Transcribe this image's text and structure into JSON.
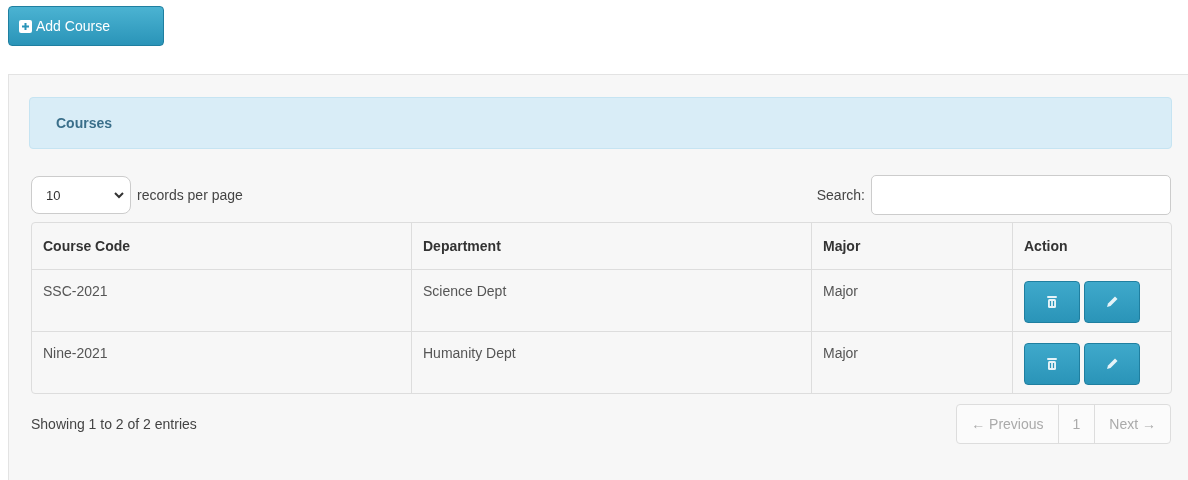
{
  "add_button": {
    "label": "Add Course"
  },
  "panel": {
    "heading": "Courses"
  },
  "length_select": {
    "value": "10",
    "label": "records per page"
  },
  "search": {
    "label": "Search:"
  },
  "table": {
    "columns": [
      "Course Code",
      "Department",
      "Major",
      "Action"
    ],
    "rows": [
      {
        "cells": [
          "SSC-2021",
          "Science Dept",
          "Major"
        ]
      },
      {
        "cells": [
          "Nine-2021",
          "Humanity Dept",
          "Major"
        ]
      }
    ]
  },
  "info": "Showing 1 to 2 of 2 entries",
  "pagination": [
    {
      "label": "← Previous",
      "disabled": true
    },
    {
      "label": "1",
      "disabled": true
    },
    {
      "label": "Next →",
      "disabled": true
    }
  ]
}
